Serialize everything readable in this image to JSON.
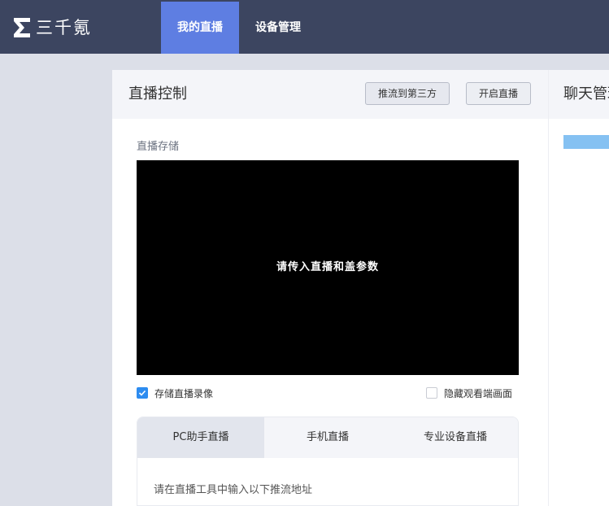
{
  "brand": {
    "name": "三千氪",
    "logo_icon": "sigma-logo-icon"
  },
  "nav": {
    "items": [
      {
        "label": "我的直播",
        "active": true
      },
      {
        "label": "设备管理",
        "active": false
      }
    ]
  },
  "control": {
    "title": "直播控制",
    "push_third_party": "推流到第三方",
    "start_live": "开启直播",
    "storage_label": "直播存储",
    "video_message": "请传入直播和盖参数",
    "record_checkbox": {
      "label": "存储直播录像",
      "checked": true
    },
    "hide_checkbox": {
      "label": "隐藏观看端画面",
      "checked": false
    },
    "tabs": [
      {
        "label": "PC助手直播",
        "active": true
      },
      {
        "label": "手机直播",
        "active": false
      },
      {
        "label": "专业设备直播",
        "active": false
      }
    ],
    "tab_hint": "请在直播工具中输入以下推流地址"
  },
  "chat": {
    "title": "聊天管理"
  },
  "colors": {
    "topbar": "#3c4560",
    "nav_active": "#5e7ee2",
    "checkbox": "#2d8cf0",
    "chat_bar": "#85c1f2"
  }
}
